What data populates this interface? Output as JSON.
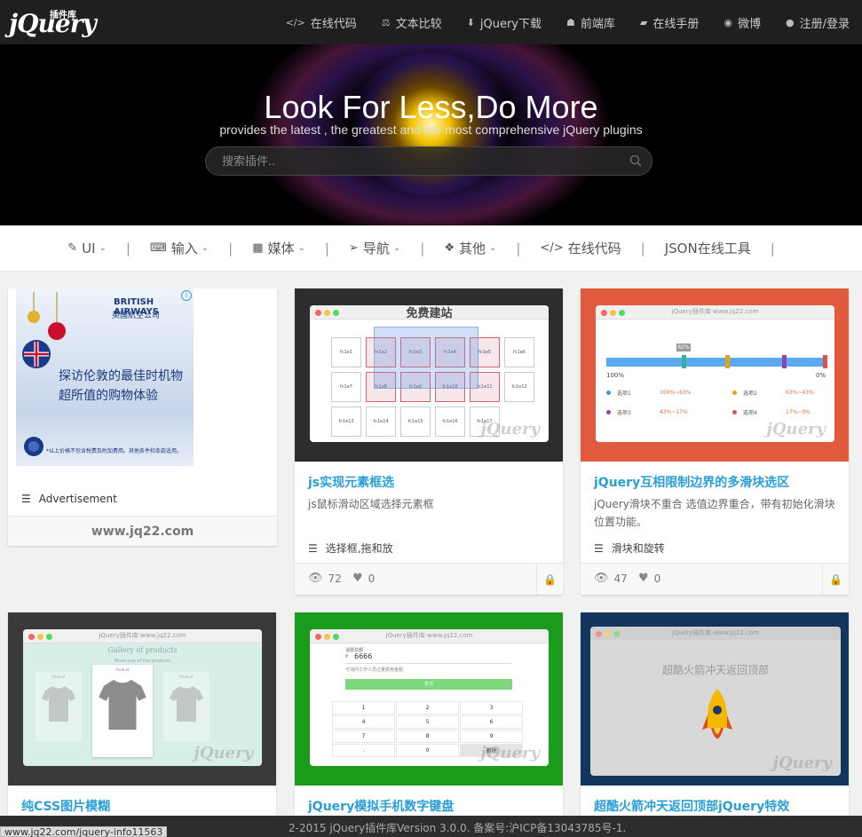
{
  "logo": {
    "text": "jQuery",
    "small": "插件库"
  },
  "topnav": [
    {
      "icon": "code-icon",
      "glyph": "</>",
      "label": "在线代码"
    },
    {
      "icon": "scale-icon",
      "glyph": "⚖",
      "label": "文本比较"
    },
    {
      "icon": "download-icon",
      "glyph": "⬇",
      "label": "jQuery下载"
    },
    {
      "icon": "user-secret-icon",
      "glyph": "☗",
      "label": "前端库"
    },
    {
      "icon": "book-icon",
      "glyph": "▰",
      "label": "在线手册"
    },
    {
      "icon": "weibo-icon",
      "glyph": "◉",
      "label": "微博"
    },
    {
      "icon": "user-icon",
      "glyph": "●",
      "label": "注册/登录"
    }
  ],
  "hero": {
    "title": "Look For Less,Do More",
    "subtitle": "provides the latest , the greatest and the most comprehensive jQuery plugins",
    "search_placeholder": "搜索插件.."
  },
  "categories": [
    {
      "icon": "brush-icon",
      "glyph": "✎",
      "label": "UI",
      "dropdown": true
    },
    {
      "icon": "keyboard-icon",
      "glyph": "⌨",
      "label": "输入",
      "dropdown": true
    },
    {
      "icon": "film-icon",
      "glyph": "▦",
      "label": "媒体",
      "dropdown": true
    },
    {
      "icon": "paper-plane-icon",
      "glyph": "➢",
      "label": "导航",
      "dropdown": true
    },
    {
      "icon": "dropbox-icon",
      "glyph": "❖",
      "label": "其他",
      "dropdown": true
    },
    {
      "icon": "code-icon",
      "glyph": "</>",
      "label": "在线代码",
      "dropdown": false
    },
    {
      "icon": "",
      "glyph": "",
      "label": "JSON在线工具",
      "dropdown": false
    }
  ],
  "ad": {
    "brand": "BRITISH AIRWAYS",
    "brand_cn": "英国航空公司",
    "text": "探访伦敦的最佳时机物超所值的购物体验",
    "fine": "*以上价格不包含税费及附加费用。其他条件和条款适用。",
    "label": "Advertisement",
    "site": "www.jq22.com"
  },
  "cards": [
    {
      "title": "js实现元素框选",
      "desc": "js鼠标滑动区域选择元素框",
      "tags": "选择框,拖和放",
      "views": "72",
      "likes": "0",
      "shot_title": "免费建站",
      "cells": [
        "fc1e1",
        "fc1e2",
        "fc1e3",
        "fc1e4",
        "fc1e5",
        "fc1e6",
        "fc1e7",
        "fc1e8",
        "fc1e9",
        "fc1e10",
        "fc1e11",
        "fc1e12",
        "fc1e13",
        "fc1e14",
        "fc1e15",
        "fc1e16",
        "fc1e17"
      ]
    },
    {
      "title": "jQuery互相限制边界的多滑块选区",
      "desc": "jQuery滑块不重合 选值边界重合，带有初始化滑块位置功能。",
      "tags": "滑块和旋转",
      "views": "47",
      "likes": "0",
      "shot_title": "jQuery插件库-www.jq22.com",
      "slider": {
        "badge": "62%",
        "left": "100%",
        "right": "0%",
        "opts": [
          {
            "name": "选项1",
            "range": "100%~63%",
            "color": "#3a9ad9"
          },
          {
            "name": "选项2",
            "range": "63%~43%",
            "color": "#e3a21a"
          },
          {
            "name": "选项3",
            "range": "43%~17%",
            "color": "#8e44ad"
          },
          {
            "name": "选项4",
            "range": "17%~0%",
            "color": "#d9534f"
          }
        ]
      }
    },
    {
      "title": "纯CSS图片模糊",
      "shot_title": "jQuery插件库-www.jq22.com",
      "gallery": "Gallery of products",
      "gallery_sub": "Move one of the products",
      "product": "Product"
    },
    {
      "title": "jQuery模拟手机数字键盘",
      "shot_title": "jQuery插件库-www.jq22.com",
      "amount_label": "消费总额",
      "amount": "6666",
      "hint": "可询问工作人员过量费用金额",
      "pay": "支付",
      "keys": [
        "1",
        "2",
        "3",
        "4",
        "5",
        "6",
        "7",
        "8",
        "9",
        ".",
        "0",
        "删除"
      ]
    },
    {
      "title": "超酷火箭冲天返回顶部jQuery特效",
      "shot_title": "jQuery插件库-www.jq22.com",
      "heading": "超酷火箭冲天返回顶部"
    }
  ],
  "watermark": "jQuery",
  "status": {
    "url": "www.jq22.com/jquery-info11563",
    "copyright": "2-2015 jQuery插件库Version 3.0.0. 备案号:沪ICP备13043785号-1."
  }
}
